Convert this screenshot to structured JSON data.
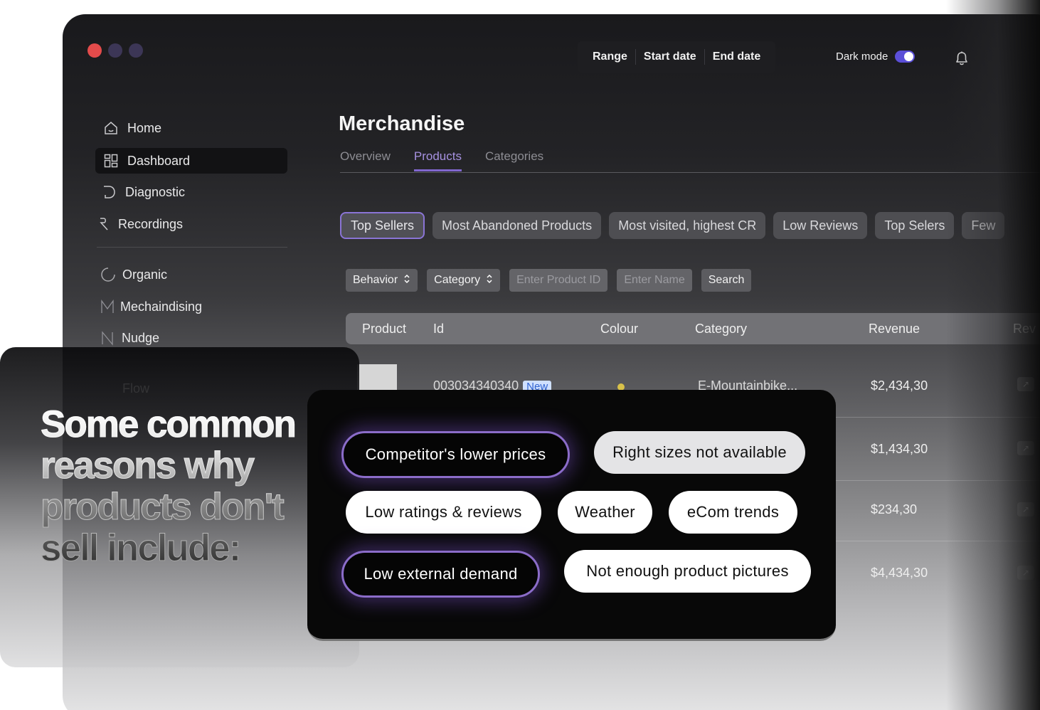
{
  "window": {
    "range_bar": {
      "range": "Range",
      "start": "Start date",
      "end": "End date"
    },
    "dark_mode_label": "Dark mode",
    "dark_mode_on": true
  },
  "sidebar": {
    "items": [
      {
        "label": "Home",
        "icon": "home-icon"
      },
      {
        "label": "Dashboard",
        "icon": "dashboard-icon",
        "active": true
      },
      {
        "label": "Diagnostic",
        "icon": "diagnostic-icon"
      },
      {
        "label": "Recordings",
        "icon": "recordings-icon"
      },
      {
        "label": "Organic",
        "icon": "organic-icon"
      },
      {
        "label": "Mechaindising",
        "icon": "m-icon"
      },
      {
        "label": "Nudge",
        "icon": "n-icon"
      },
      {
        "label": "Flow",
        "icon": "flow-icon"
      }
    ]
  },
  "main": {
    "title": "Merchandise",
    "tabs": [
      {
        "label": "Overview"
      },
      {
        "label": "Products",
        "active": true
      },
      {
        "label": "Categories"
      }
    ],
    "chips": [
      "Top Sellers",
      "Most Abandoned Products",
      "Most visited, highest CR",
      "Low Reviews",
      "Top Selers",
      "Few"
    ],
    "filters": {
      "behavior": "Behavior",
      "category": "Category",
      "product_id_placeholder": "Enter Product ID",
      "name_placeholder": "Enter Name",
      "search": "Search"
    },
    "table": {
      "headers": [
        "Product",
        "Id",
        "Colour",
        "Category",
        "Revenue",
        "Rev"
      ],
      "rows": [
        {
          "id": "003034340340",
          "badge": "New",
          "category": "E-Mountainbike...",
          "revenue": "$2,434,30"
        },
        {
          "revenue": "$1,434,30"
        },
        {
          "revenue": "$234,30"
        },
        {
          "revenue": "$4,434,30"
        }
      ]
    }
  },
  "overlay": {
    "headline": "Some common reasons why products don't sell include:"
  },
  "reasons": [
    {
      "label": "Competitor's lower prices",
      "style": "dark"
    },
    {
      "label": "Right sizes not available",
      "style": "grey"
    },
    {
      "label": "Low ratings & reviews",
      "style": "light"
    },
    {
      "label": "Weather",
      "style": "light"
    },
    {
      "label": "eCom trends",
      "style": "light"
    },
    {
      "label": "Low external demand",
      "style": "dark"
    },
    {
      "label": "Not enough product pictures",
      "style": "light"
    }
  ],
  "colors": {
    "accent": "#8167cf",
    "close_dot": "#e34b4b",
    "badge": "#cfe0ff"
  }
}
